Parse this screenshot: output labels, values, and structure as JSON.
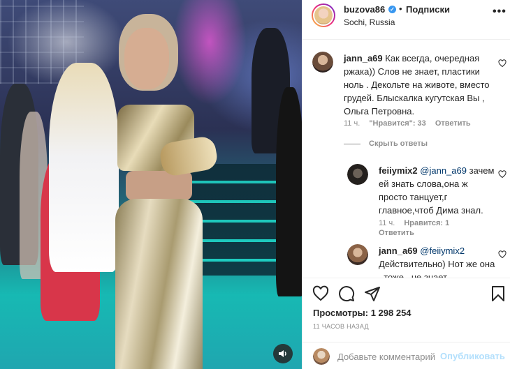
{
  "post": {
    "username": "buzova86",
    "verified": "✓",
    "separator": "•",
    "follow_label": "Подписки",
    "location": "Sochi, Russia",
    "more_label": "•••"
  },
  "comments": [
    {
      "username": "jann_a69",
      "text": "Как всегда, очередная ржака)) Слов не знает, пластики ноль . Декольте на животе, вместо грудей. Блыскалка кугутская Вы , Ольга Петровна.",
      "age": "11 ч.",
      "likes": "\"Нравится\": 33",
      "reply_label": "Ответить"
    }
  ],
  "hide_replies_label": "Скрыть ответы",
  "replies": [
    {
      "username": "feiiymix2",
      "mention": "@jann_a69",
      "text": "зачем ей знать слова,она ж просто танцует,г главное,чтоб Дима знал.",
      "age": "11 ч.",
      "likes": "Нравится: 1",
      "reply_label": "Ответить"
    },
    {
      "username": "jann_a69",
      "mention": "@feiiymix2",
      "text": "Действительно) Нот же она , тоже , не знает"
    }
  ],
  "stats": {
    "views_label": "Просмотры: 1 298 254",
    "time_ago": "11 ЧАСОВ НАЗАД"
  },
  "add_comment": {
    "placeholder": "Добавьте комментарий...",
    "publish_label": "Опубликовать"
  },
  "icons": [
    "sound-icon",
    "heart-icon",
    "comment-icon",
    "share-icon",
    "bookmark-icon",
    "more-icon",
    "verified-icon"
  ],
  "colors": {
    "link": "#00376b",
    "verified": "#3897f0",
    "publish_disabled": "#b2dffc",
    "muted": "#8e8e8e"
  }
}
